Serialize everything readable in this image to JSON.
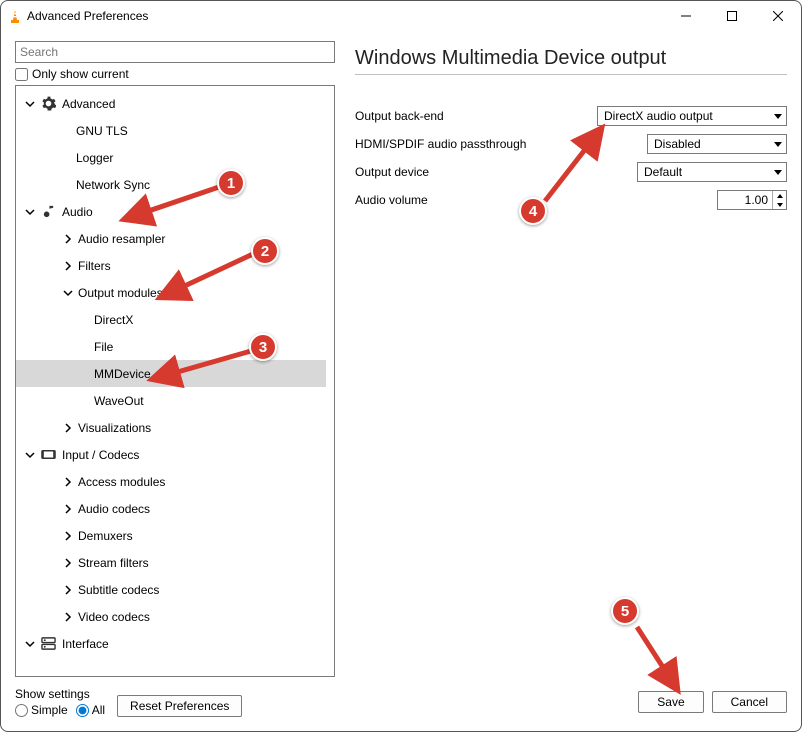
{
  "window": {
    "title": "Advanced Preferences"
  },
  "search": {
    "placeholder": "Search"
  },
  "only_show_current": {
    "label": "Only show current"
  },
  "tree": [
    {
      "type": "cat",
      "icon": "gear",
      "label": "Advanced",
      "chev": "down",
      "indent": "indent0"
    },
    {
      "type": "leaf",
      "label": "GNU TLS",
      "indent": "indent2b"
    },
    {
      "type": "leaf",
      "label": "Logger",
      "indent": "indent2b"
    },
    {
      "type": "leaf",
      "label": "Network Sync",
      "indent": "indent2b"
    },
    {
      "type": "cat",
      "icon": "audio",
      "label": "Audio",
      "chev": "down",
      "indent": "indent0"
    },
    {
      "type": "sub",
      "label": "Audio resampler",
      "chev": "right",
      "indent": "indent2"
    },
    {
      "type": "sub",
      "label": "Filters",
      "chev": "right",
      "indent": "indent2"
    },
    {
      "type": "sub",
      "label": "Output modules",
      "chev": "down",
      "indent": "indent2"
    },
    {
      "type": "leaf",
      "label": "DirectX",
      "indent": "indent3",
      "pad": true
    },
    {
      "type": "leaf",
      "label": "File",
      "indent": "indent3",
      "pad": true
    },
    {
      "type": "leaf",
      "label": "MMDevice",
      "indent": "indent3",
      "pad": true,
      "selected": true
    },
    {
      "type": "leaf",
      "label": "WaveOut",
      "indent": "indent3",
      "pad": true
    },
    {
      "type": "sub",
      "label": "Visualizations",
      "chev": "right",
      "indent": "indent2"
    },
    {
      "type": "cat",
      "icon": "codec",
      "label": "Input / Codecs",
      "chev": "down",
      "indent": "indent0"
    },
    {
      "type": "sub",
      "label": "Access modules",
      "chev": "right",
      "indent": "indent2"
    },
    {
      "type": "sub",
      "label": "Audio codecs",
      "chev": "right",
      "indent": "indent2"
    },
    {
      "type": "sub",
      "label": "Demuxers",
      "chev": "right",
      "indent": "indent2"
    },
    {
      "type": "sub",
      "label": "Stream filters",
      "chev": "right",
      "indent": "indent2"
    },
    {
      "type": "sub",
      "label": "Subtitle codecs",
      "chev": "right",
      "indent": "indent2"
    },
    {
      "type": "sub",
      "label": "Video codecs",
      "chev": "right",
      "indent": "indent2"
    },
    {
      "type": "cat",
      "icon": "interface",
      "label": "Interface",
      "chev": "down",
      "indent": "indent0"
    }
  ],
  "panel": {
    "title": "Windows Multimedia Device output",
    "fields": {
      "backend": {
        "label": "Output back-end",
        "value": "DirectX audio output"
      },
      "passthrough": {
        "label": "HDMI/SPDIF audio passthrough",
        "value": "Disabled"
      },
      "device": {
        "label": "Output device",
        "value": "Default"
      },
      "volume": {
        "label": "Audio volume",
        "value": "1.00"
      }
    }
  },
  "show_settings": {
    "label": "Show settings",
    "simple": "Simple",
    "all": "All"
  },
  "buttons": {
    "reset": "Reset Preferences",
    "save": "Save",
    "cancel": "Cancel"
  },
  "annotations": {
    "b1": "1",
    "b2": "2",
    "b3": "3",
    "b4": "4",
    "b5": "5"
  }
}
